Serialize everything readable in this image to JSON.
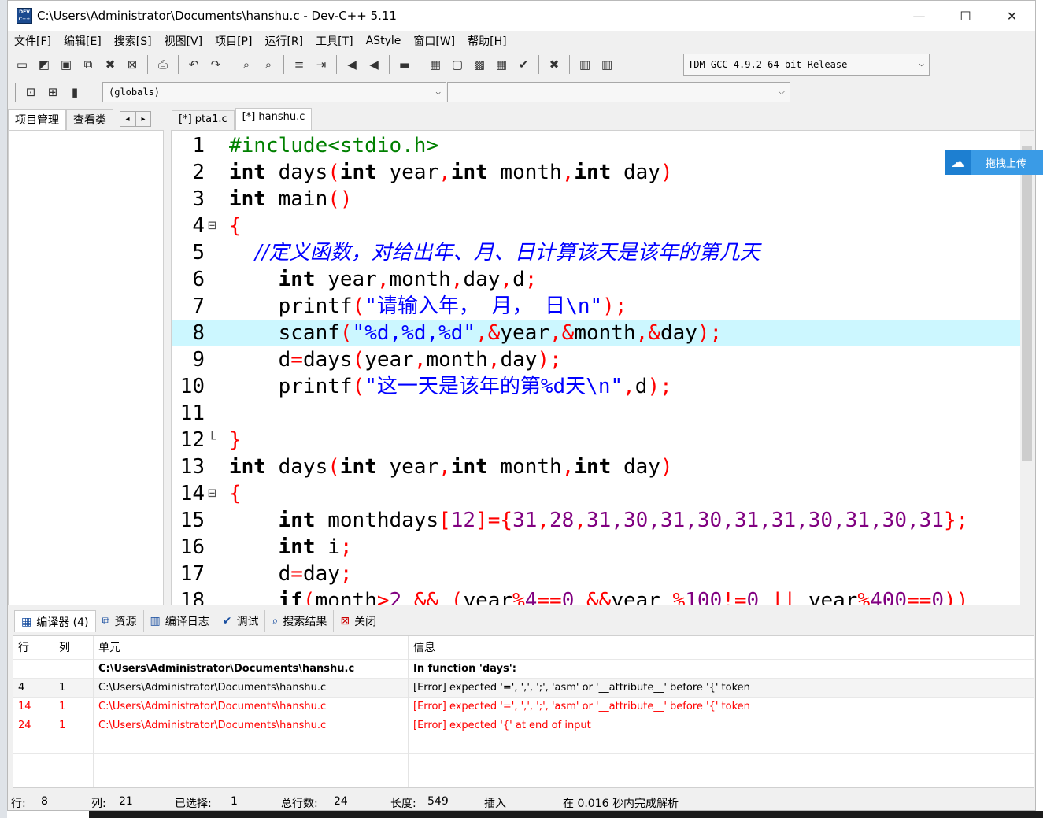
{
  "window": {
    "title": "C:\\Users\\Administrator\\Documents\\hanshu.c - Dev-C++ 5.11",
    "app_icon_text": "DEV C++"
  },
  "menu": [
    "文件[F]",
    "编辑[E]",
    "搜索[S]",
    "视图[V]",
    "项目[P]",
    "运行[R]",
    "工具[T]",
    "AStyle",
    "窗口[W]",
    "帮助[H]"
  ],
  "toolbar": {
    "compiler": "TDM-GCC 4.9.2 64-bit Release",
    "globals": "(globals)"
  },
  "left_tabs": [
    "项目管理",
    "查看类"
  ],
  "file_tabs": [
    "[*] pta1.c",
    "[*] hanshu.c"
  ],
  "baidu_upload": "拖拽上传",
  "editor": {
    "current_line": 8,
    "lines": [
      {
        "n": "1",
        "fold": ""
      },
      {
        "n": "2",
        "fold": ""
      },
      {
        "n": "3",
        "fold": ""
      },
      {
        "n": "4",
        "fold": "⊟"
      },
      {
        "n": "5",
        "fold": ""
      },
      {
        "n": "6",
        "fold": ""
      },
      {
        "n": "7",
        "fold": ""
      },
      {
        "n": "8",
        "fold": ""
      },
      {
        "n": "9",
        "fold": ""
      },
      {
        "n": "10",
        "fold": ""
      },
      {
        "n": "11",
        "fold": ""
      },
      {
        "n": "12",
        "fold": "└"
      },
      {
        "n": "13",
        "fold": ""
      },
      {
        "n": "14",
        "fold": "⊟"
      },
      {
        "n": "15",
        "fold": ""
      },
      {
        "n": "16",
        "fold": ""
      },
      {
        "n": "17",
        "fold": ""
      },
      {
        "n": "18",
        "fold": ""
      }
    ],
    "code": {
      "l1": "#include<stdio.h>",
      "l2_a": "int",
      "l2_b": " days",
      "l2_c": "(",
      "l2_d": "int",
      "l2_e": " year",
      "l2_f": ",",
      "l2_g": "int",
      "l2_h": " month",
      "l2_i": ",",
      "l2_j": "int",
      "l2_k": " day",
      "l2_l": ")",
      "l3_a": "int",
      "l3_b": " main",
      "l3_c": "()",
      "l4": "{",
      "l5": "    //定义函数，对给出年、月、日计算该天是该年的第几天",
      "l6_a": "    int",
      "l6_b": " year",
      "l6_c": ",",
      "l6_d": "month",
      "l6_e": ",",
      "l6_f": "day",
      "l6_g": ",",
      "l6_h": "d",
      "l6_i": ";",
      "l7_a": "    printf",
      "l7_b": "(",
      "l7_c": "\"请输入年， 月， 日\\n\"",
      "l7_d": ");",
      "l8_a": "    scanf",
      "l8_b": "(",
      "l8_c": "\"%d,%d,%d\"",
      "l8_d": ",&",
      "l8_e": "year",
      "l8_f": ",&",
      "l8_g": "month",
      "l8_h": ",&",
      "l8_i": "day",
      "l8_j": ");",
      "l9_a": "    d",
      "l9_b": "=",
      "l9_c": "days",
      "l9_d": "(",
      "l9_e": "year",
      "l9_f": ",",
      "l9_g": "month",
      "l9_h": ",",
      "l9_i": "day",
      "l9_j": ");",
      "l10_a": "    printf",
      "l10_b": "(",
      "l10_c": "\"这一天是该年的第%d天\\n\"",
      "l10_d": ",",
      "l10_e": "d",
      "l10_f": ");",
      "l12": "}",
      "l13_a": "int",
      "l13_b": " days",
      "l13_c": "(",
      "l13_d": "int",
      "l13_e": " year",
      "l13_f": ",",
      "l13_g": "int",
      "l13_h": " month",
      "l13_i": ",",
      "l13_j": "int",
      "l13_k": " day",
      "l13_l": ")",
      "l14": "{",
      "l15_a": "    int",
      "l15_b": " monthdays",
      "l15_c": "[",
      "l15_d": "12",
      "l15_e": "]={",
      "l15_f": "31",
      "l15_g": ",",
      "l15_h": "28",
      "l15_i": ",",
      "l15_j": "31,30,31,30,31,31,30,31,30,31",
      "l15_k": "};",
      "l16_a": "    int",
      "l16_b": " i",
      "l16_c": ";",
      "l17_a": "    d",
      "l17_b": "=",
      "l17_c": "day",
      "l17_d": ";",
      "l18_a": "    if",
      "l18_b": "(",
      "l18_c": "month",
      "l18_d": ">",
      "l18_e": "2",
      "l18_f": " && (",
      "l18_g": "year",
      "l18_h": "%",
      "l18_i": "4",
      "l18_j": "==",
      "l18_k": "0",
      "l18_l": " &&",
      "l18_m": "year ",
      "l18_n": "%",
      "l18_o": "100",
      "l18_p": "!=",
      "l18_q": "0",
      "l18_r": " || ",
      "l18_s": "year",
      "l18_t": "%",
      "l18_u": "400",
      "l18_v": "==",
      "l18_w": "0",
      "l18_x": "))"
    }
  },
  "bottom_tabs": [
    {
      "label": "编译器 (4)",
      "icon": "grid-icon"
    },
    {
      "label": "资源",
      "icon": "resources-icon"
    },
    {
      "label": "编译日志",
      "icon": "chart-icon"
    },
    {
      "label": "调试",
      "icon": "check-icon"
    },
    {
      "label": "搜索结果",
      "icon": "search-icon"
    },
    {
      "label": "关闭",
      "icon": "close-icon"
    }
  ],
  "messages": {
    "headers": [
      "行",
      "列",
      "单元",
      "信息"
    ],
    "rows": [
      {
        "line": "",
        "col": "",
        "unit": "C:\\Users\\Administrator\\Documents\\hanshu.c",
        "msg": "In function 'days':",
        "type": "info"
      },
      {
        "line": "4",
        "col": "1",
        "unit": "C:\\Users\\Administrator\\Documents\\hanshu.c",
        "msg": "[Error] expected '=', ',', ';', 'asm' or '__attribute__' before '{' token",
        "type": "normal"
      },
      {
        "line": "14",
        "col": "1",
        "unit": "C:\\Users\\Administrator\\Documents\\hanshu.c",
        "msg": "[Error] expected '=', ',', ';', 'asm' or '__attribute__' before '{' token",
        "type": "error"
      },
      {
        "line": "24",
        "col": "1",
        "unit": "C:\\Users\\Administrator\\Documents\\hanshu.c",
        "msg": "[Error] expected '{' at end of input",
        "type": "error"
      }
    ]
  },
  "status": {
    "row_label": "行:",
    "row_val": "8",
    "col_label": "列:",
    "col_val": "21",
    "sel_label": "已选择:",
    "sel_val": "1",
    "total_label": "总行数:",
    "total_val": "24",
    "len_label": "长度:",
    "len_val": "549",
    "mode": "插入",
    "parse": "在 0.016 秒内完成解析"
  },
  "colors": {
    "current_line": "#ccf7ff",
    "symbol": "#ff0000",
    "string": "#0000ff",
    "number": "#800080",
    "error": "#ff0000"
  }
}
